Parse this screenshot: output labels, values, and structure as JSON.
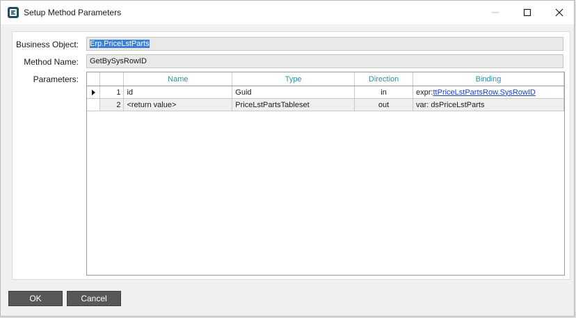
{
  "window": {
    "title": "Setup Method Parameters",
    "app_icon": "epicor-e-icon",
    "controls": [
      "minimize-icon",
      "maximize-icon",
      "close-icon"
    ]
  },
  "form": {
    "business_object_label": "Business Object:",
    "business_object_value": "Erp.PriceLstParts",
    "method_name_label": "Method Name:",
    "method_name_value": "GetBySysRowID",
    "parameters_label": "Parameters:"
  },
  "grid": {
    "columns": [
      "Name",
      "Type",
      "Direction",
      "Binding"
    ],
    "rows": [
      {
        "index": "1",
        "name": "id",
        "type": "Guid",
        "direction": "in",
        "binding_prefix": "expr:",
        "binding_link": "ttPriceLstPartsRow.SysRowID",
        "current": true
      },
      {
        "index": "2",
        "name": "<return value>",
        "type": "PriceLstPartsTableset",
        "direction": "out",
        "binding_prefix": "var: dsPriceLstParts",
        "binding_link": "",
        "current": false
      }
    ]
  },
  "buttons": {
    "ok": "OK",
    "cancel": "Cancel"
  },
  "colors": {
    "header_text": "#2d8fad",
    "button_bg": "#585858",
    "selection": "#3d7fd6",
    "link": "#1a3fcc"
  }
}
